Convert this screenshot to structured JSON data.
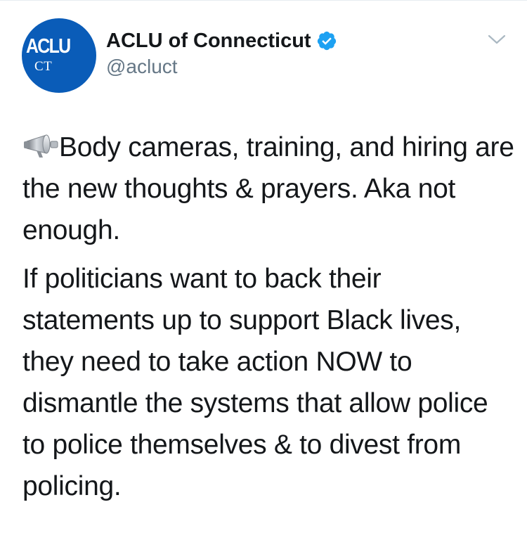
{
  "account": {
    "avatar_text_top": "ACLU",
    "avatar_text_bottom": "CT",
    "display_name": "ACLU of Connecticut",
    "handle": "@acluct",
    "verified": true
  },
  "tweet": {
    "paragraphs": [
      "Body cameras, training, and hiring are the new thoughts & prayers. Aka not enough.",
      "If politicians want to back their statements up to support Black lives, they need to take action NOW to dismantle the systems that allow police to police themselves & to divest from policing."
    ]
  },
  "icons": {
    "verified": "verified-badge-icon",
    "menu": "chevron-down-icon",
    "emoji": "megaphone-icon"
  },
  "colors": {
    "avatar_bg": "#0a5cb8",
    "verified_blue": "#1da1f2",
    "handle_gray": "#657786",
    "text": "#14171a"
  }
}
